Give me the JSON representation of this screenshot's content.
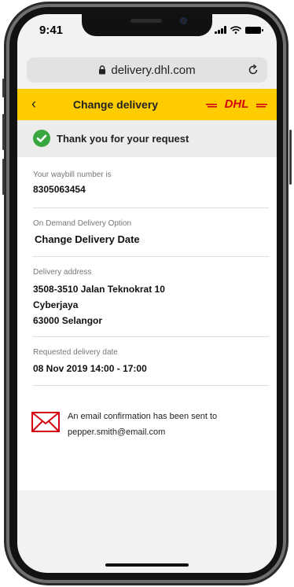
{
  "status": {
    "time": "9:41"
  },
  "browser": {
    "url": "delivery.dhl.com"
  },
  "header": {
    "back_symbol": "‹",
    "title": "Change delivery",
    "brand": "DHL",
    "brand_color": "#d40511",
    "accent_color": "#ffcc00"
  },
  "confirmation": {
    "message": "Thank you for your request",
    "icon_color": "#3aa63f"
  },
  "details": {
    "waybill_label": "Your waybill number is",
    "waybill_number": "8305063454",
    "option_label": "On Demand Delivery Option",
    "option_value": "Change Delivery Date",
    "address_label": "Delivery address",
    "address_lines": [
      "3508-3510 Jalan Teknokrat 10",
      "Cyberjaya",
      "63000 Selangor"
    ],
    "date_label": "Requested delivery date",
    "date_value": "08 Nov 2019 14:00 - 17:00"
  },
  "email": {
    "message": "An email confirmation has been sent to",
    "address": "pepper.smith@email.com"
  },
  "icons": [
    "lock-icon",
    "reload-icon",
    "back-icon",
    "check-circle-icon",
    "mail-icon",
    "signal-icon",
    "wifi-icon",
    "battery-icon"
  ]
}
